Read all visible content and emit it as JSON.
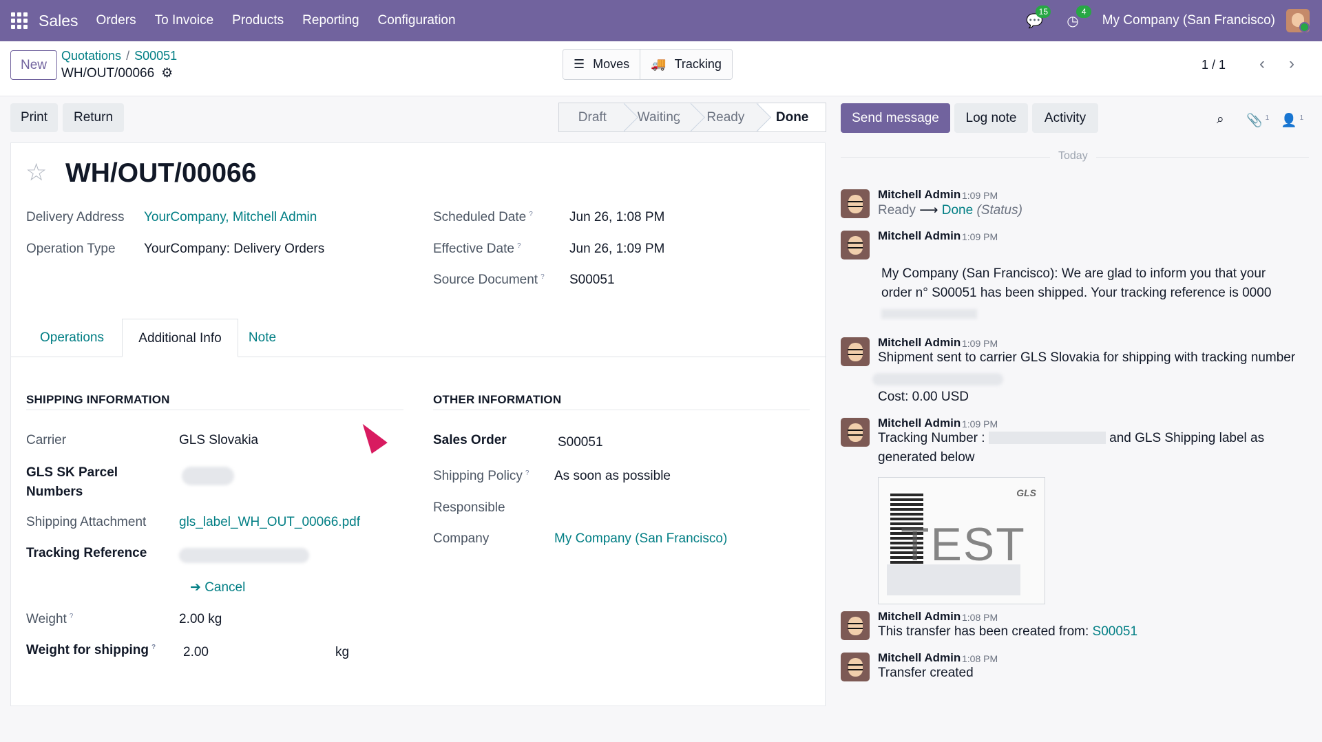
{
  "topbar": {
    "app": "Sales",
    "menus": [
      "Orders",
      "To Invoice",
      "Products",
      "Reporting",
      "Configuration"
    ],
    "messages_count": "15",
    "activities_count": "4",
    "company": "My Company (San Francisco)"
  },
  "control": {
    "new_label": "New",
    "breadcrumb": [
      "Quotations",
      "S00051"
    ],
    "record_name": "WH/OUT/00066",
    "moves_label": "Moves",
    "tracking_label": "Tracking",
    "pager": "1 / 1"
  },
  "actions": {
    "print": "Print",
    "return": "Return",
    "statuses": [
      "Draft",
      "Waiting",
      "Ready",
      "Done"
    ],
    "current_status": "Done",
    "send_message": "Send message",
    "log_note": "Log note",
    "activity": "Activity",
    "attachments_count": "1",
    "followers_count": "1"
  },
  "form": {
    "title": "WH/OUT/00066",
    "delivery_address_label": "Delivery Address",
    "delivery_address": "YourCompany, Mitchell Admin",
    "operation_type_label": "Operation Type",
    "operation_type": "YourCompany: Delivery Orders",
    "scheduled_date_label": "Scheduled Date",
    "scheduled_date": "Jun 26, 1:08 PM",
    "effective_date_label": "Effective Date",
    "effective_date": "Jun 26, 1:09 PM",
    "source_document_label": "Source Document",
    "source_document": "S00051",
    "tabs": [
      "Operations",
      "Additional Info",
      "Note"
    ],
    "shipping_section": "SHIPPING INFORMATION",
    "other_section": "OTHER INFORMATION",
    "carrier_label": "Carrier",
    "carrier": "GLS Slovakia",
    "parcel_label": "GLS SK Parcel Numbers",
    "attachment_label": "Shipping Attachment",
    "attachment": "gls_label_WH_OUT_00066.pdf",
    "tracking_label": "Tracking Reference",
    "cancel": "Cancel",
    "weight_label": "Weight",
    "weight": "2.00",
    "weight_unit": "kg",
    "weight_shipping_label": "Weight for shipping",
    "weight_shipping": "2.00",
    "weight_shipping_unit": "kg",
    "sales_order_label": "Sales Order",
    "sales_order": "S00051",
    "shipping_policy_label": "Shipping Policy",
    "shipping_policy": "As soon as possible",
    "responsible_label": "Responsible",
    "company_label": "Company",
    "company": "My Company (San Francisco)"
  },
  "chatter": {
    "today": "Today",
    "author": "Mitchell Admin",
    "messages": [
      {
        "time": "1:09 PM",
        "line1": "Ready",
        "line2": "Done",
        "line3": "(Status)"
      },
      {
        "time": "1:09 PM",
        "text": "My Company (San Francisco): We are glad to inform you that your order n° S00051 has been shipped. Your tracking reference is 0000"
      },
      {
        "time": "1:09 PM",
        "text": "Shipment sent to carrier GLS Slovakia for shipping with tracking number",
        "cost": "Cost: 0.00 USD"
      },
      {
        "time": "1:09 PM",
        "text": "Tracking Number :",
        "text2": "and GLS Shipping label as generated below",
        "label_mark": "GLS",
        "label_test": "TEST"
      },
      {
        "time": "1:08 PM",
        "text": "This transfer has been created from:",
        "link": "S00051"
      },
      {
        "time": "1:08 PM",
        "text": "Transfer created"
      }
    ]
  }
}
